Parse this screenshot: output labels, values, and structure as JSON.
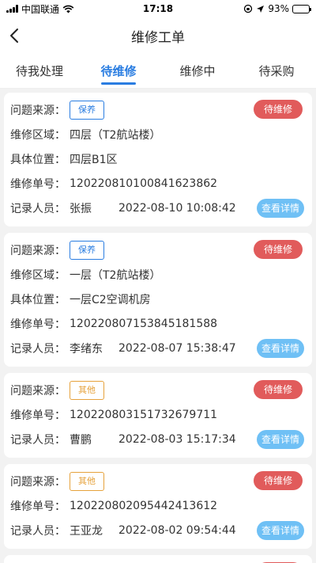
{
  "status_bar": {
    "carrier": "中国联通",
    "time": "17:18",
    "battery_percent": "93%",
    "battery_level": 0.93
  },
  "header": {
    "title": "维修工单"
  },
  "tabs": [
    {
      "label": "待我处理"
    },
    {
      "label": "待维修"
    },
    {
      "label": "维修中"
    },
    {
      "label": "待采购"
    }
  ],
  "labels": {
    "source": "问题来源：",
    "area": "维修区域：",
    "location": "具体位置：",
    "order_no": "维修单号：",
    "recorder": "记录人员："
  },
  "detail_button": "查看详情",
  "orders": [
    {
      "source": "保养",
      "status": "待维修",
      "area": "四层（T2航站楼）",
      "location": "四层B1区",
      "order_no": "120220810100841623862",
      "recorder": "张振",
      "time": "2022-08-10 10:08:42"
    },
    {
      "source": "保养",
      "status": "待维修",
      "area": "一层（T2航站楼）",
      "location": "一层C2空调机房",
      "order_no": "120220807153845181588",
      "recorder": "李绪东",
      "time": "2022-08-07 15:38:47"
    },
    {
      "source": "其他",
      "status": "待维修",
      "order_no": "120220803151732679711",
      "recorder": "曹鹏",
      "time": "2022-08-03 15:17:34"
    },
    {
      "source": "其他",
      "status": "待维修",
      "order_no": "120220802095442413612",
      "recorder": "王亚龙",
      "time": "2022-08-02 09:54:44"
    }
  ],
  "colors": {
    "accent": "#2a7de1",
    "status_red": "#e15b5b",
    "detail_blue": "#6fc0f5",
    "tag_orange": "#e6a23c"
  }
}
